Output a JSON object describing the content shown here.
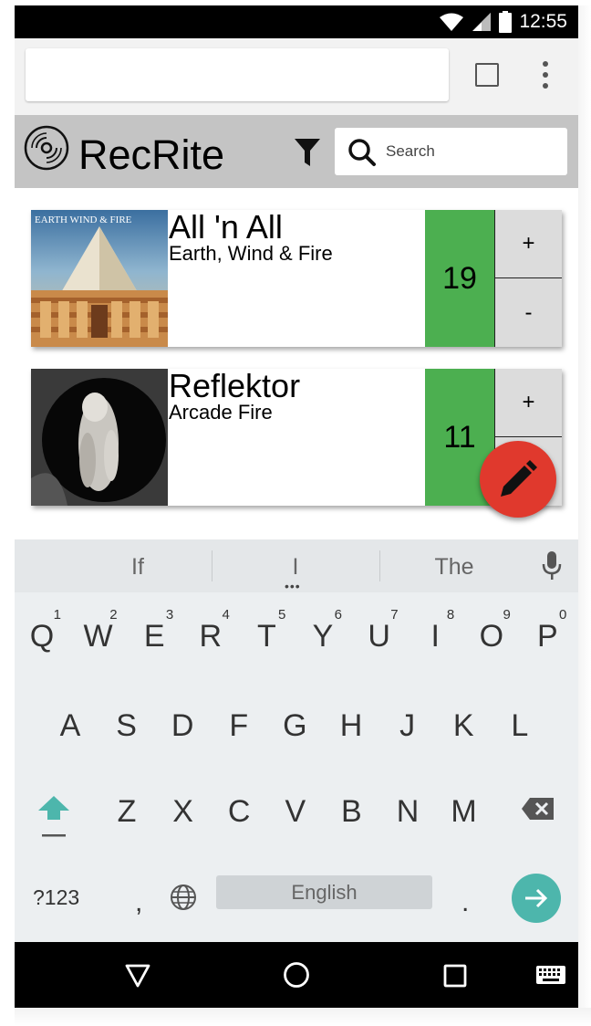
{
  "status_bar": {
    "time": "12:55"
  },
  "browser": {
    "url_value": ""
  },
  "app": {
    "title": "RecRite",
    "search": {
      "placeholder": "Search"
    }
  },
  "records": [
    {
      "title": "All 'n All",
      "artist": "Earth, Wind & Fire",
      "count": "19",
      "cover_text": "EARTH WIND & FIRE",
      "plus": "+",
      "minus": "-"
    },
    {
      "title": "Reflektor",
      "artist": "Arcade Fire",
      "count": "11",
      "plus": "+",
      "minus": "-"
    }
  ],
  "colors": {
    "count_bg": "#4caf50",
    "fab": "#e0392d",
    "header_bg": "#c4c4c4",
    "enter_key": "#4db6ac"
  },
  "keyboard": {
    "suggestions": [
      "If",
      "I",
      "The"
    ],
    "row1": [
      {
        "k": "Q",
        "n": "1"
      },
      {
        "k": "W",
        "n": "2"
      },
      {
        "k": "E",
        "n": "3"
      },
      {
        "k": "R",
        "n": "4"
      },
      {
        "k": "T",
        "n": "5"
      },
      {
        "k": "Y",
        "n": "6"
      },
      {
        "k": "U",
        "n": "7"
      },
      {
        "k": "I",
        "n": "8"
      },
      {
        "k": "O",
        "n": "9"
      },
      {
        "k": "P",
        "n": "0"
      }
    ],
    "row2": [
      "A",
      "S",
      "D",
      "F",
      "G",
      "H",
      "J",
      "K",
      "L"
    ],
    "row3": [
      "Z",
      "X",
      "C",
      "V",
      "B",
      "N",
      "M"
    ],
    "symbols": "?123",
    "comma": ",",
    "space": "English",
    "period": "."
  }
}
